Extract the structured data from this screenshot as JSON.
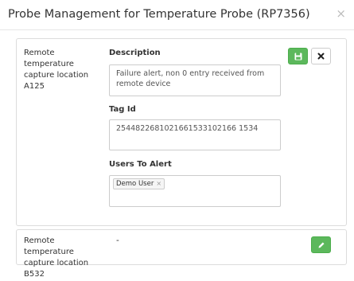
{
  "modal": {
    "title": "Probe Management for Temperature Probe (RP7356)",
    "close_glyph": "×"
  },
  "probes": [
    {
      "location": "Remote temperature capture location A125",
      "description_label": "Description",
      "description_value": "Failure alert, non 0 entry received from remote device",
      "tag_label": "Tag Id",
      "tag_value": "2544822681021661533102166 1534",
      "users_label": "Users To Alert",
      "users": [
        {
          "name": "Demo User",
          "remove_glyph": "×"
        }
      ],
      "save_icon": "floppy-disk-icon",
      "cancel_icon": "close-icon",
      "save_color": "#5cb85c"
    },
    {
      "location": "Remote temperature capture location B532",
      "description_value": "-",
      "edit_icon": "pencil-icon",
      "edit_color": "#5cb85c"
    }
  ]
}
